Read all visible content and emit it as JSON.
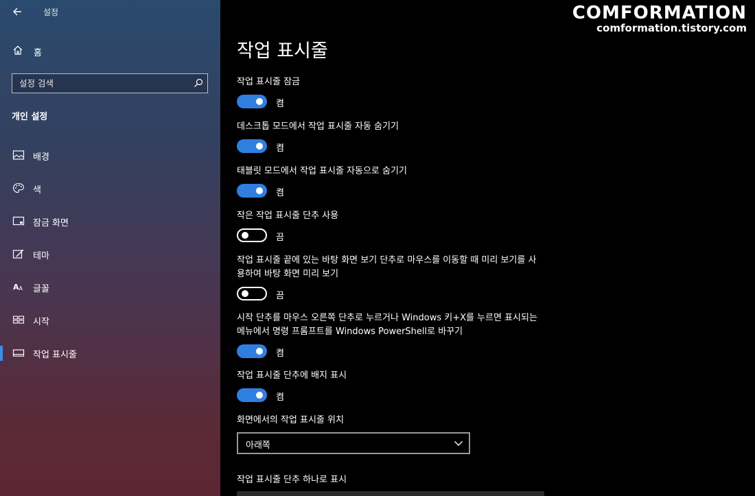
{
  "window": {
    "title": "설정"
  },
  "sidebar": {
    "home_label": "홈",
    "search_placeholder": "설정 검색",
    "section_title": "개인 설정",
    "items": [
      {
        "label": "배경",
        "icon": "picture-icon"
      },
      {
        "label": "색",
        "icon": "palette-icon"
      },
      {
        "label": "잠금 화면",
        "icon": "lock-screen-icon"
      },
      {
        "label": "테마",
        "icon": "theme-icon"
      },
      {
        "label": "글꼴",
        "icon": "font-icon"
      },
      {
        "label": "시작",
        "icon": "start-icon"
      },
      {
        "label": "작업 표시줄",
        "icon": "taskbar-icon",
        "selected": true
      }
    ]
  },
  "main": {
    "title": "작업 표시줄",
    "settings": [
      {
        "label": "작업 표시줄 잠금",
        "state": "켬",
        "on": true
      },
      {
        "label": "데스크톱 모드에서 작업 표시줄 자동 숨기기",
        "state": "켬",
        "on": true
      },
      {
        "label": "태블릿 모드에서 작업 표시줄 자동으로 숨기기",
        "state": "켬",
        "on": true
      },
      {
        "label": "작은 작업 표시줄 단추 사용",
        "state": "끔",
        "on": false
      },
      {
        "label": "작업 표시줄 끝에 있는 바탕 화면 보기 단추로 마우스를 이동할 때 미리 보기를 사용하여 바탕 화면 미리 보기",
        "state": "끔",
        "on": false
      },
      {
        "label": "시작 단추를 마우스 오른쪽 단추로 누르거나 Windows 키+X를 누르면 표시되는 메뉴에서 명령 프롬프트를 Windows PowerShell로 바꾸기",
        "state": "켬",
        "on": true
      },
      {
        "label": "작업 표시줄 단추에 배지 표시",
        "state": "켬",
        "on": true
      }
    ],
    "position_label": "화면에서의 작업 표시줄 위치",
    "position_value": "아래쪽",
    "combine_label": "작업 표시줄 단추 하나로 표시"
  },
  "watermark": {
    "line1": "COMFORMATION",
    "line2": "comformation.tistory.com"
  },
  "colors": {
    "accent": "#2f7fe0",
    "highlight_top": "#ff1a7a",
    "highlight_bottom": "#ffb400"
  }
}
